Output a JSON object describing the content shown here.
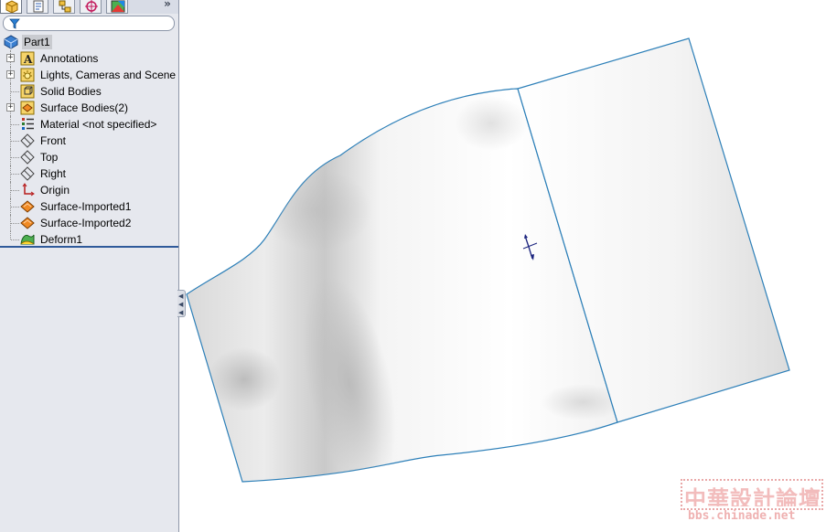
{
  "tabs": [
    {
      "name": "feature-manager-tab-icon",
      "active": true
    },
    {
      "name": "property-manager-tab-icon",
      "active": false
    },
    {
      "name": "configuration-manager-tab-icon",
      "active": false
    },
    {
      "name": "dimxpert-manager-tab-icon",
      "active": false
    },
    {
      "name": "display-manager-tab-icon",
      "active": false
    }
  ],
  "tabbar": {
    "overflow_glyph": "»"
  },
  "tree": {
    "root": {
      "label": "Part1",
      "icon": "part-icon"
    },
    "items": [
      {
        "label": "Annotations",
        "icon": "annotations-icon",
        "expandable": true
      },
      {
        "label": "Lights, Cameras and Scene",
        "icon": "lights-icon",
        "expandable": true
      },
      {
        "label": "Solid Bodies",
        "icon": "solid-bodies-folder-icon",
        "expandable": false
      },
      {
        "label": "Surface Bodies(2)",
        "icon": "surface-bodies-folder-icon",
        "expandable": true
      },
      {
        "label": "Material <not specified>",
        "icon": "material-icon",
        "expandable": false
      },
      {
        "label": "Front",
        "icon": "plane-icon",
        "expandable": false
      },
      {
        "label": "Top",
        "icon": "plane-icon",
        "expandable": false
      },
      {
        "label": "Right",
        "icon": "plane-icon",
        "expandable": false
      },
      {
        "label": "Origin",
        "icon": "origin-icon",
        "expandable": false
      },
      {
        "label": "Surface-Imported1",
        "icon": "imported-surface-icon",
        "expandable": false
      },
      {
        "label": "Surface-Imported2",
        "icon": "imported-surface-icon",
        "expandable": false
      },
      {
        "label": "Deform1",
        "icon": "deform-icon",
        "expandable": false
      }
    ]
  },
  "watermark": {
    "title": "中華設計論壇",
    "url": "bbs.chinade.net"
  },
  "colors": {
    "edge": "#2c7fb8",
    "panel": "#e6e8ee",
    "selection": "#c9cbd0",
    "watermark": "#f2bcbc"
  }
}
